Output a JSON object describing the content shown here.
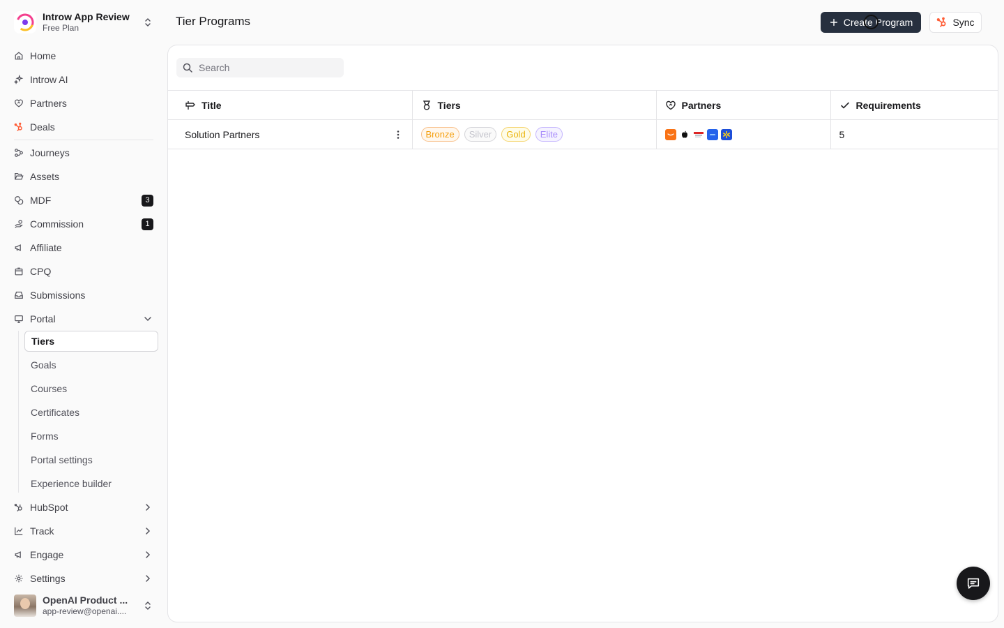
{
  "workspace": {
    "name": "Introw App Review",
    "plan": "Free Plan"
  },
  "nav": {
    "home": "Home",
    "ai": "Introw AI",
    "partners": "Partners",
    "deals": "Deals",
    "journeys": "Journeys",
    "assets": "Assets",
    "mdf": {
      "label": "MDF",
      "badge": "3"
    },
    "commission": {
      "label": "Commission",
      "badge": "1"
    },
    "affiliate": "Affiliate",
    "cpq": "CPQ",
    "submissions": "Submissions",
    "portal": "Portal",
    "portal_sub": {
      "tiers": "Tiers",
      "goals": "Goals",
      "courses": "Courses",
      "certificates": "Certificates",
      "forms": "Forms",
      "portal_settings": "Portal settings",
      "experience_builder": "Experience builder"
    },
    "hubspot": "HubSpot",
    "track": "Track",
    "engage": "Engage",
    "settings": "Settings"
  },
  "user": {
    "name": "OpenAI Product ...",
    "email": "app-review@openai...."
  },
  "header": {
    "title": "Tier Programs",
    "create_label": "Create Program",
    "sync_label": "Sync"
  },
  "search": {
    "placeholder": "Search"
  },
  "table": {
    "columns": {
      "title": "Title",
      "tiers": "Tiers",
      "partners": "Partners",
      "requirements": "Requirements"
    },
    "rows": [
      {
        "title": "Solution Partners",
        "tiers": [
          {
            "label": "Bronze",
            "color": "#f59e0b",
            "border": "#f8c08a",
            "bg": "#fff7ed"
          },
          {
            "label": "Silver",
            "color": "#c4c4cc",
            "border": "#d4d4d8",
            "bg": "#fafafa"
          },
          {
            "label": "Gold",
            "color": "#eab308",
            "border": "#f5d36b",
            "bg": "#fefce8"
          },
          {
            "label": "Elite",
            "color": "#a78bfa",
            "border": "#c4b5fd",
            "bg": "#f5f3ff"
          }
        ],
        "partner_logos": [
          "amazon-logo",
          "apple-logo",
          "target-logo",
          "google-logo",
          "walmart-logo"
        ],
        "requirements": "5"
      }
    ]
  },
  "colors": {
    "accent": "#27303f",
    "hubspot": "#ff5c35"
  }
}
